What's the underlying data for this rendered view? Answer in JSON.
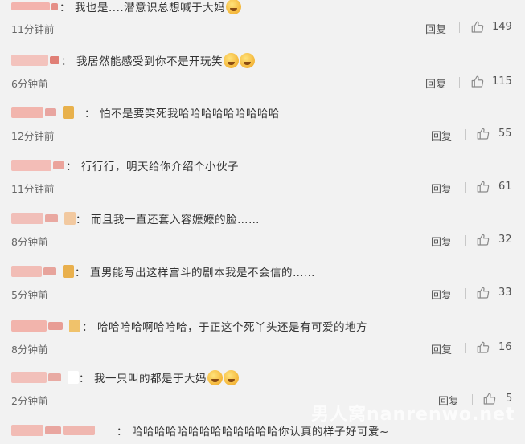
{
  "comments": [
    {
      "text": "我也是....潜意识总想喊于大妈",
      "emojis": 1,
      "time": "11分钟前",
      "reply": "回复",
      "likes": "149"
    },
    {
      "text": "我居然能感受到你不是开玩笑",
      "emojis": 2,
      "time": "6分钟前",
      "reply": "回复",
      "likes": "115"
    },
    {
      "text": "怕不是要笑死我哈哈哈哈哈哈哈哈哈",
      "emojis": 0,
      "time": "12分钟前",
      "reply": "回复",
      "likes": "55"
    },
    {
      "text": "行行行，明天给你介绍个小伙子",
      "emojis": 0,
      "time": "11分钟前",
      "reply": "回复",
      "likes": "61"
    },
    {
      "text": "而且我一直还套入容嬷嬷的脸……",
      "emojis": 0,
      "time": "8分钟前",
      "reply": "回复",
      "likes": "32"
    },
    {
      "text": "直男能写出这样宫斗的剧本我是不会信的……",
      "emojis": 0,
      "time": "5分钟前",
      "reply": "回复",
      "likes": "33"
    },
    {
      "text": "哈哈哈哈啊哈哈哈，于正这个死丫头还是有可爱的地方",
      "emojis": 0,
      "time": "8分钟前",
      "reply": "回复",
      "likes": "16"
    },
    {
      "text": "我一只叫的都是于大妈",
      "emojis": 2,
      "time": "2分钟前",
      "reply": "回复",
      "likes": "5"
    },
    {
      "text": "哈哈哈哈哈哈哈哈哈哈哈哈哈你认真的样子好可爱~",
      "emojis": 0,
      "time": "",
      "reply": "",
      "likes": ""
    }
  ],
  "watermark": "男人窝nanrenwo.net",
  "colors": {
    "background": "#f2f2f2",
    "text": "#333333",
    "meta": "#666666",
    "blur": "#f0a9a0"
  },
  "icons": {
    "like": "thumbs-up-icon",
    "emoji": "laughing-emoji-icon"
  }
}
